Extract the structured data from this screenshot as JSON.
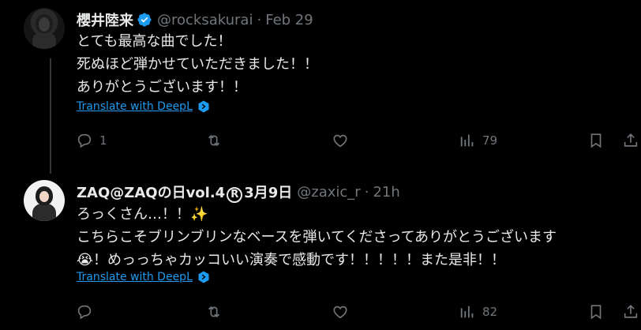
{
  "tweets": [
    {
      "name": "櫻井陸来",
      "handle": "@rocksakurai",
      "separator": "·",
      "time": "Feb 29",
      "lines": [
        "とても最高な曲でした！",
        "死ぬほど弾かせていただきました！！",
        "ありがとうございます！！"
      ],
      "translate": "Translate with DeepL",
      "replies": "1",
      "views": "79"
    },
    {
      "name_prefix": "ZAQ@ZAQの日vol.4",
      "name_reg": "R",
      "name_suffix": "3月9日",
      "handle": "@zaxic_r",
      "separator": "·",
      "time": "21h",
      "lines": [
        "ろっくさん…！！",
        "こちらこそブリンブリンなベースを弾いてくださってありがとうございます",
        "！めっっちゃカッコいい演奏で感動です！！！！！また是非！！"
      ],
      "line1_emoji": "✨",
      "line3_emoji": "😭",
      "translate": "Translate with DeepL",
      "views": "82"
    }
  ],
  "icons": [
    "verified-badge-icon",
    "deepl-icon",
    "reply-icon",
    "retweet-icon",
    "like-icon",
    "views-icon",
    "bookmark-icon",
    "share-icon"
  ],
  "colors": {
    "background": "#000000",
    "text": "#e7e9ea",
    "muted": "#71767b",
    "accent": "#1d9bf0"
  }
}
